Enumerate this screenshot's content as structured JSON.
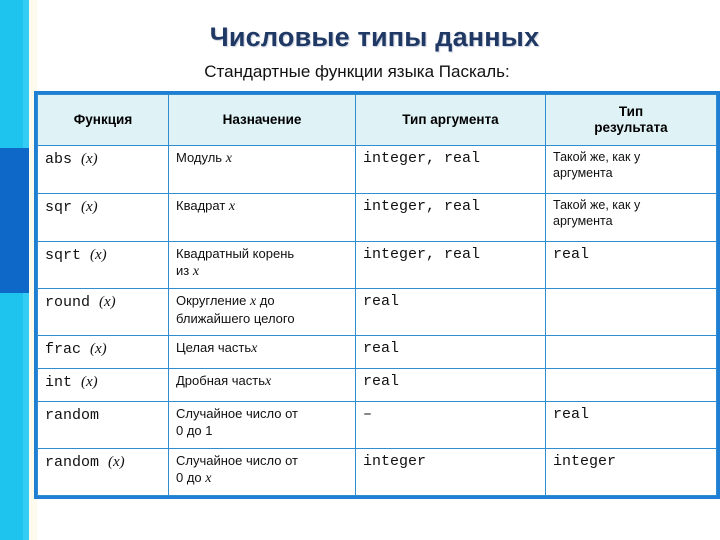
{
  "slide": {
    "title": "Числовые типы данных",
    "subtitle": "Стандартные функции языка Паскаль:",
    "accent_cyan": "#1ec3ee",
    "accent_blue": "#0e68c8",
    "title_color": "#1f3864",
    "table_border_color": "#1f7fd4",
    "header_fill": "#dff2f6"
  },
  "table": {
    "headers": {
      "function": "Функция",
      "purpose": "Назначение",
      "arg_type": "Тип аргумента",
      "result_type_line1": "Тип",
      "result_type_line2": "результата"
    },
    "rows": [
      {
        "func_name": "abs",
        "func_arg": "(x)",
        "purpose_line1": "Модуль",
        "purpose_var": "x",
        "purpose_line2": "",
        "arg_type": "integer, real",
        "result_text_line1": "Такой же, как у",
        "result_text_line2": "аргумента",
        "result_mono": ""
      },
      {
        "func_name": "sqr",
        "func_arg": "(x)",
        "purpose_line1": "Квадрат",
        "purpose_var": "x",
        "purpose_line2": "",
        "arg_type": "integer, real",
        "result_text_line1": "Такой же, как у",
        "result_text_line2": "аргумента",
        "result_mono": ""
      },
      {
        "func_name": "sqrt",
        "func_arg": "(x)",
        "purpose_line1": "Квадратный корень",
        "purpose_line2": "из",
        "purpose_var": "x",
        "arg_type": "integer, real",
        "result_text_line1": "",
        "result_text_line2": "",
        "result_mono": "real"
      },
      {
        "func_name": "round",
        "func_arg": "(x)",
        "purpose_line1": "Округление",
        "purpose_var": "x",
        "purpose_line1_tail": "до",
        "purpose_line2": "ближайшего целого",
        "arg_type": "real",
        "result_text_line1": "",
        "result_text_line2": "",
        "result_mono": ""
      },
      {
        "func_name": "frac",
        "func_arg": "(x)",
        "purpose_line1": "Целая часть",
        "purpose_var": "x",
        "purpose_line2": "",
        "arg_type": "real",
        "result_text_line1": "",
        "result_text_line2": "",
        "result_mono": ""
      },
      {
        "func_name": "int",
        "func_arg": "(x)",
        "purpose_line1": "Дробная часть",
        "purpose_var": "x",
        "purpose_line2": "",
        "arg_type": "real",
        "result_text_line1": "",
        "result_text_line2": "",
        "result_mono": ""
      },
      {
        "func_name": "random",
        "func_arg": "",
        "purpose_line1": "Случайное число от",
        "purpose_line2": "0 до 1",
        "purpose_var": "",
        "arg_type": "–",
        "result_text_line1": "",
        "result_text_line2": "",
        "result_mono": "real"
      },
      {
        "func_name": "random",
        "func_arg": "(x)",
        "purpose_line1": "Случайное число от",
        "purpose_line2": "0 до",
        "purpose_var": "x",
        "arg_type": "integer",
        "result_text_line1": "",
        "result_text_line2": "",
        "result_mono": "integer"
      }
    ]
  }
}
